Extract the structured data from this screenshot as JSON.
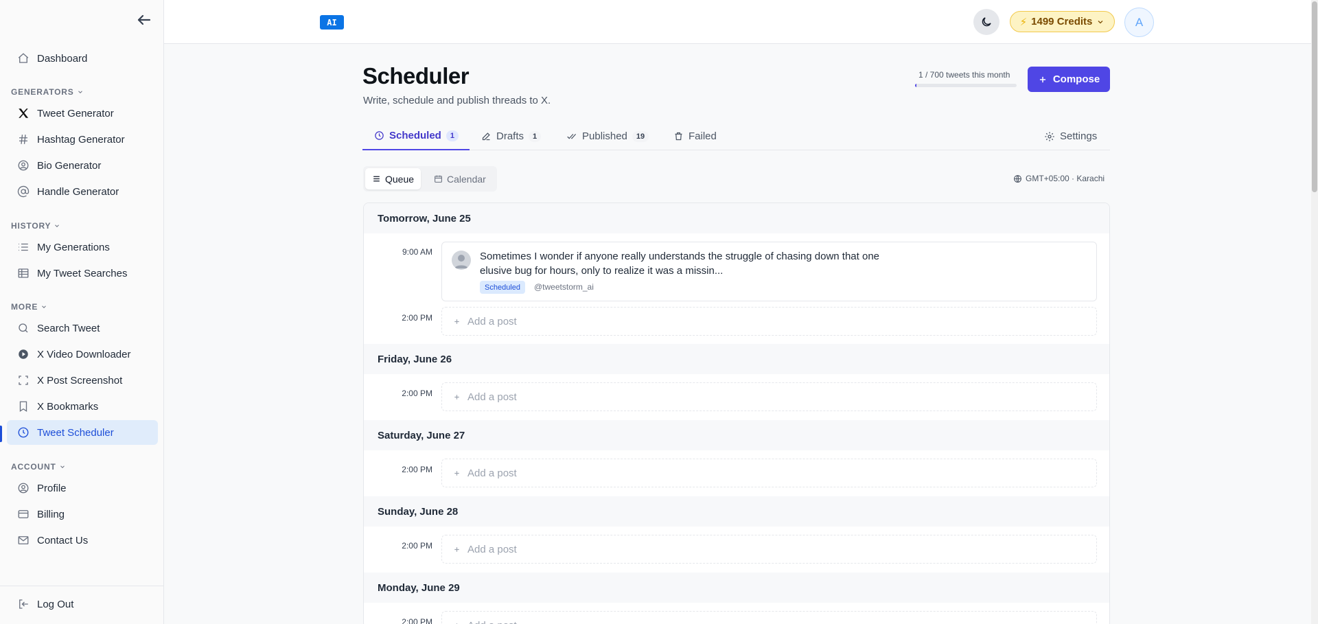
{
  "sidebar": {
    "dashboard": "Dashboard",
    "sections": {
      "generators": "GENERATORS",
      "history": "HISTORY",
      "more": "MORE",
      "account": "ACCOUNT"
    },
    "generators": [
      "Tweet Generator",
      "Hashtag Generator",
      "Bio Generator",
      "Handle Generator"
    ],
    "history": [
      "My Generations",
      "My Tweet Searches"
    ],
    "more": [
      "Search Tweet",
      "X Video Downloader",
      "X Post Screenshot",
      "X Bookmarks",
      "Tweet Scheduler"
    ],
    "account": [
      "Profile",
      "Billing",
      "Contact Us"
    ],
    "logout": "Log Out",
    "active_item": "Tweet Scheduler"
  },
  "topbar": {
    "ai_badge": "AI",
    "credits": "1499 Credits",
    "avatar_initial": "A"
  },
  "page": {
    "title": "Scheduler",
    "subtitle": "Write, schedule and publish threads to X.",
    "usage": "1 / 700 tweets this month",
    "usage_fraction": 0.0014,
    "compose": "Compose"
  },
  "tabs": [
    {
      "label": "Scheduled",
      "count": "1"
    },
    {
      "label": "Drafts",
      "count": "1"
    },
    {
      "label": "Published",
      "count": "19"
    },
    {
      "label": "Failed"
    }
  ],
  "settings": "Settings",
  "view": {
    "queue": "Queue",
    "calendar": "Calendar",
    "timezone": "GMT+05:00 · Karachi"
  },
  "queue": {
    "days": [
      "Tomorrow, June 25",
      "Friday, June 26",
      "Saturday, June 27",
      "Sunday, June 28",
      "Monday, June 29"
    ],
    "post": {
      "time": "9:00 AM",
      "text": "Sometimes I wonder if anyone really understands the struggle of chasing down that one elusive bug for hours, only to realize it was a missin...",
      "status": "Scheduled",
      "handle": "@tweetstorm_ai"
    },
    "slot_time": "2:00 PM",
    "add_post": "Add a post"
  },
  "colors": {
    "accent": "#4f46e5",
    "sidebar_active": "#1d4ed8",
    "credits_bg": "#fdf3c4"
  }
}
